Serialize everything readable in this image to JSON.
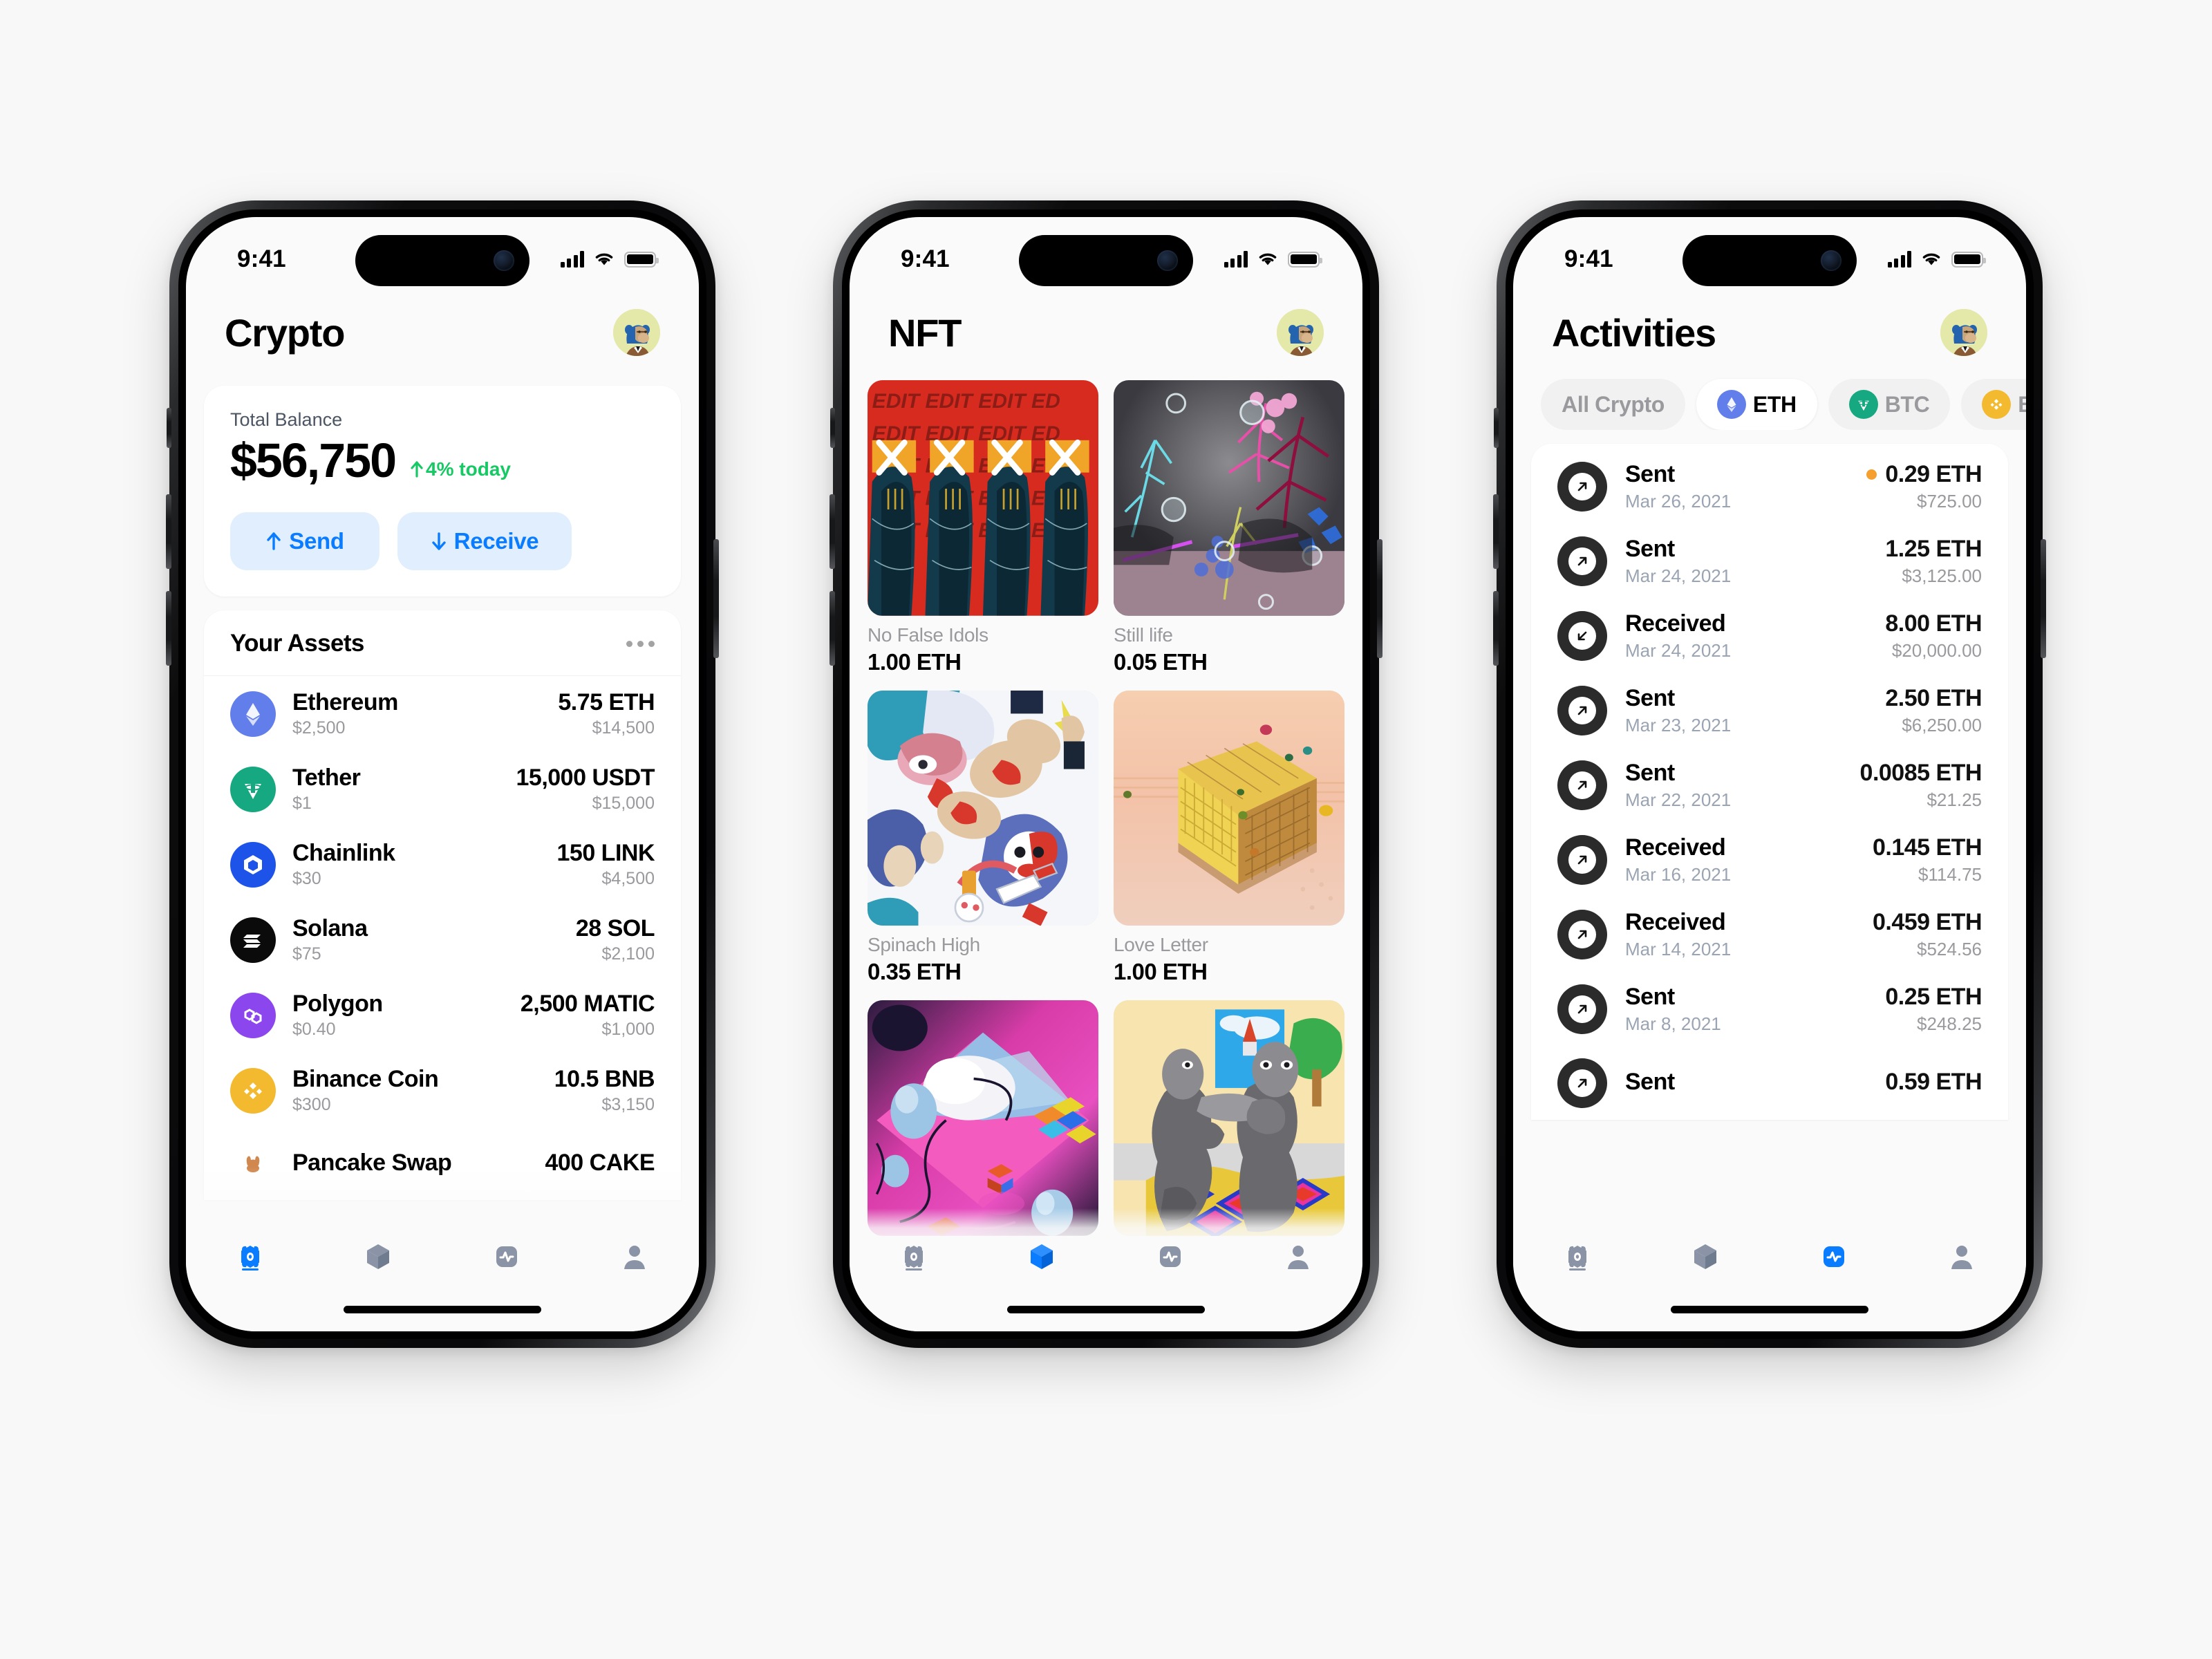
{
  "statusbar": {
    "time": "9:41",
    "signal_icon": "cellular-bars-icon",
    "wifi_icon": "wifi-icon",
    "battery_icon": "battery-icon"
  },
  "colors": {
    "accent_blue": "#0A7CFF",
    "button_bg": "#E1EEFD",
    "positive_green": "#17C964",
    "pending_orange": "#F5A02E",
    "page_bg": "#FAFAFA",
    "muted_text": "#9A9A9E",
    "date_text": "#9AA4B2"
  },
  "phone1": {
    "header": {
      "title": "Crypto",
      "avatar_name": "bored-ape-avatar"
    },
    "balance": {
      "label": "Total Balance",
      "amount": "$56,750",
      "change": "4% today",
      "change_direction": "up",
      "send_label": "Send",
      "receive_label": "Receive"
    },
    "assets": {
      "title": "Your Assets",
      "menu_icon": "more-horizontal-icon",
      "items": [
        {
          "name": "Ethereum",
          "price": "$2,500",
          "amount": "5.75 ETH",
          "value": "$14,500",
          "color": "#627EEA",
          "symbol": "ETH"
        },
        {
          "name": "Tether",
          "price": "$1",
          "amount": "15,000 USDT",
          "value": "$15,000",
          "color": "#16A880",
          "symbol": "USDT"
        },
        {
          "name": "Chainlink",
          "price": "$30",
          "amount": "150 LINK",
          "value": "$4,500",
          "color": "#1D53E8",
          "symbol": "LINK"
        },
        {
          "name": "Solana",
          "price": "$75",
          "amount": "28 SOL",
          "value": "$2,100",
          "color": "#0B0B0B",
          "symbol": "SOL"
        },
        {
          "name": "Polygon",
          "price": "$0.40",
          "amount": "2,500 MATIC",
          "value": "$1,000",
          "color": "#8B46EE",
          "symbol": "MATIC"
        },
        {
          "name": "Binance Coin",
          "price": "$300",
          "amount": "10.5 BNB",
          "value": "$3,150",
          "color": "#F3BA2F",
          "symbol": "BNB"
        },
        {
          "name": "Pancake Swap",
          "price": "",
          "amount": "400 CAKE",
          "value": "",
          "color": "#D1884F",
          "symbol": "CAKE"
        }
      ]
    },
    "tabs": [
      {
        "icon": "wallet-crypto-icon",
        "active": true
      },
      {
        "icon": "cube-nft-icon",
        "active": false
      },
      {
        "icon": "activity-pulse-icon",
        "active": false
      },
      {
        "icon": "person-profile-icon",
        "active": false
      }
    ]
  },
  "phone2": {
    "header": {
      "title": "NFT",
      "avatar_name": "bored-ape-avatar"
    },
    "nfts": [
      {
        "title": "No False Idols",
        "price": "1.00 ETH",
        "art": "red-figures-x-eyes"
      },
      {
        "title": "Still life",
        "price": "0.05 ETH",
        "art": "neon-glitch-botanical"
      },
      {
        "title": "Spinach High",
        "price": "0.35 ETH",
        "art": "doodle-collage"
      },
      {
        "title": "Love Letter",
        "price": "1.00 ETH",
        "art": "golden-cube"
      },
      {
        "title": "",
        "price": "",
        "art": "pink-isometric-diamond"
      },
      {
        "title": "",
        "price": "",
        "art": "stone-figures-duo"
      }
    ],
    "tabs": [
      {
        "icon": "wallet-crypto-icon",
        "active": false
      },
      {
        "icon": "cube-nft-icon",
        "active": true
      },
      {
        "icon": "activity-pulse-icon",
        "active": false
      },
      {
        "icon": "person-profile-icon",
        "active": false
      }
    ]
  },
  "phone3": {
    "header": {
      "title": "Activities",
      "avatar_name": "bored-ape-avatar"
    },
    "filters": [
      {
        "label": "All Crypto",
        "icon": "",
        "active": false
      },
      {
        "label": "ETH",
        "icon": "ethereum-icon",
        "active": true
      },
      {
        "label": "BTC",
        "icon": "tether-icon",
        "active": false
      },
      {
        "label": "BNB",
        "icon": "binance-icon",
        "active": false
      }
    ],
    "transactions": [
      {
        "type": "Sent",
        "date": "Mar 26, 2021",
        "amount": "0.29 ETH",
        "usd": "$725.00",
        "direction": "out",
        "pending": true
      },
      {
        "type": "Sent",
        "date": "Mar 24, 2021",
        "amount": "1.25 ETH",
        "usd": "$3,125.00",
        "direction": "out",
        "pending": false
      },
      {
        "type": "Received",
        "date": "Mar 24, 2021",
        "amount": "8.00 ETH",
        "usd": "$20,000.00",
        "direction": "in",
        "pending": false
      },
      {
        "type": "Sent",
        "date": "Mar 23, 2021",
        "amount": "2.50 ETH",
        "usd": "$6,250.00",
        "direction": "out",
        "pending": false
      },
      {
        "type": "Sent",
        "date": "Mar 22, 2021",
        "amount": "0.0085 ETH",
        "usd": "$21.25",
        "direction": "out",
        "pending": false
      },
      {
        "type": "Received",
        "date": "Mar 16, 2021",
        "amount": "0.145 ETH",
        "usd": "$114.75",
        "direction": "out",
        "pending": false
      },
      {
        "type": "Received",
        "date": "Mar 14, 2021",
        "amount": "0.459 ETH",
        "usd": "$524.56",
        "direction": "out",
        "pending": false
      },
      {
        "type": "Sent",
        "date": "Mar 8, 2021",
        "amount": "0.25 ETH",
        "usd": "$248.25",
        "direction": "out",
        "pending": false
      },
      {
        "type": "Sent",
        "date": "",
        "amount": "0.59 ETH",
        "usd": "",
        "direction": "out",
        "pending": false
      }
    ],
    "tabs": [
      {
        "icon": "wallet-crypto-icon",
        "active": false
      },
      {
        "icon": "cube-nft-icon",
        "active": false
      },
      {
        "icon": "activity-pulse-icon",
        "active": true
      },
      {
        "icon": "person-profile-icon",
        "active": false
      }
    ]
  }
}
